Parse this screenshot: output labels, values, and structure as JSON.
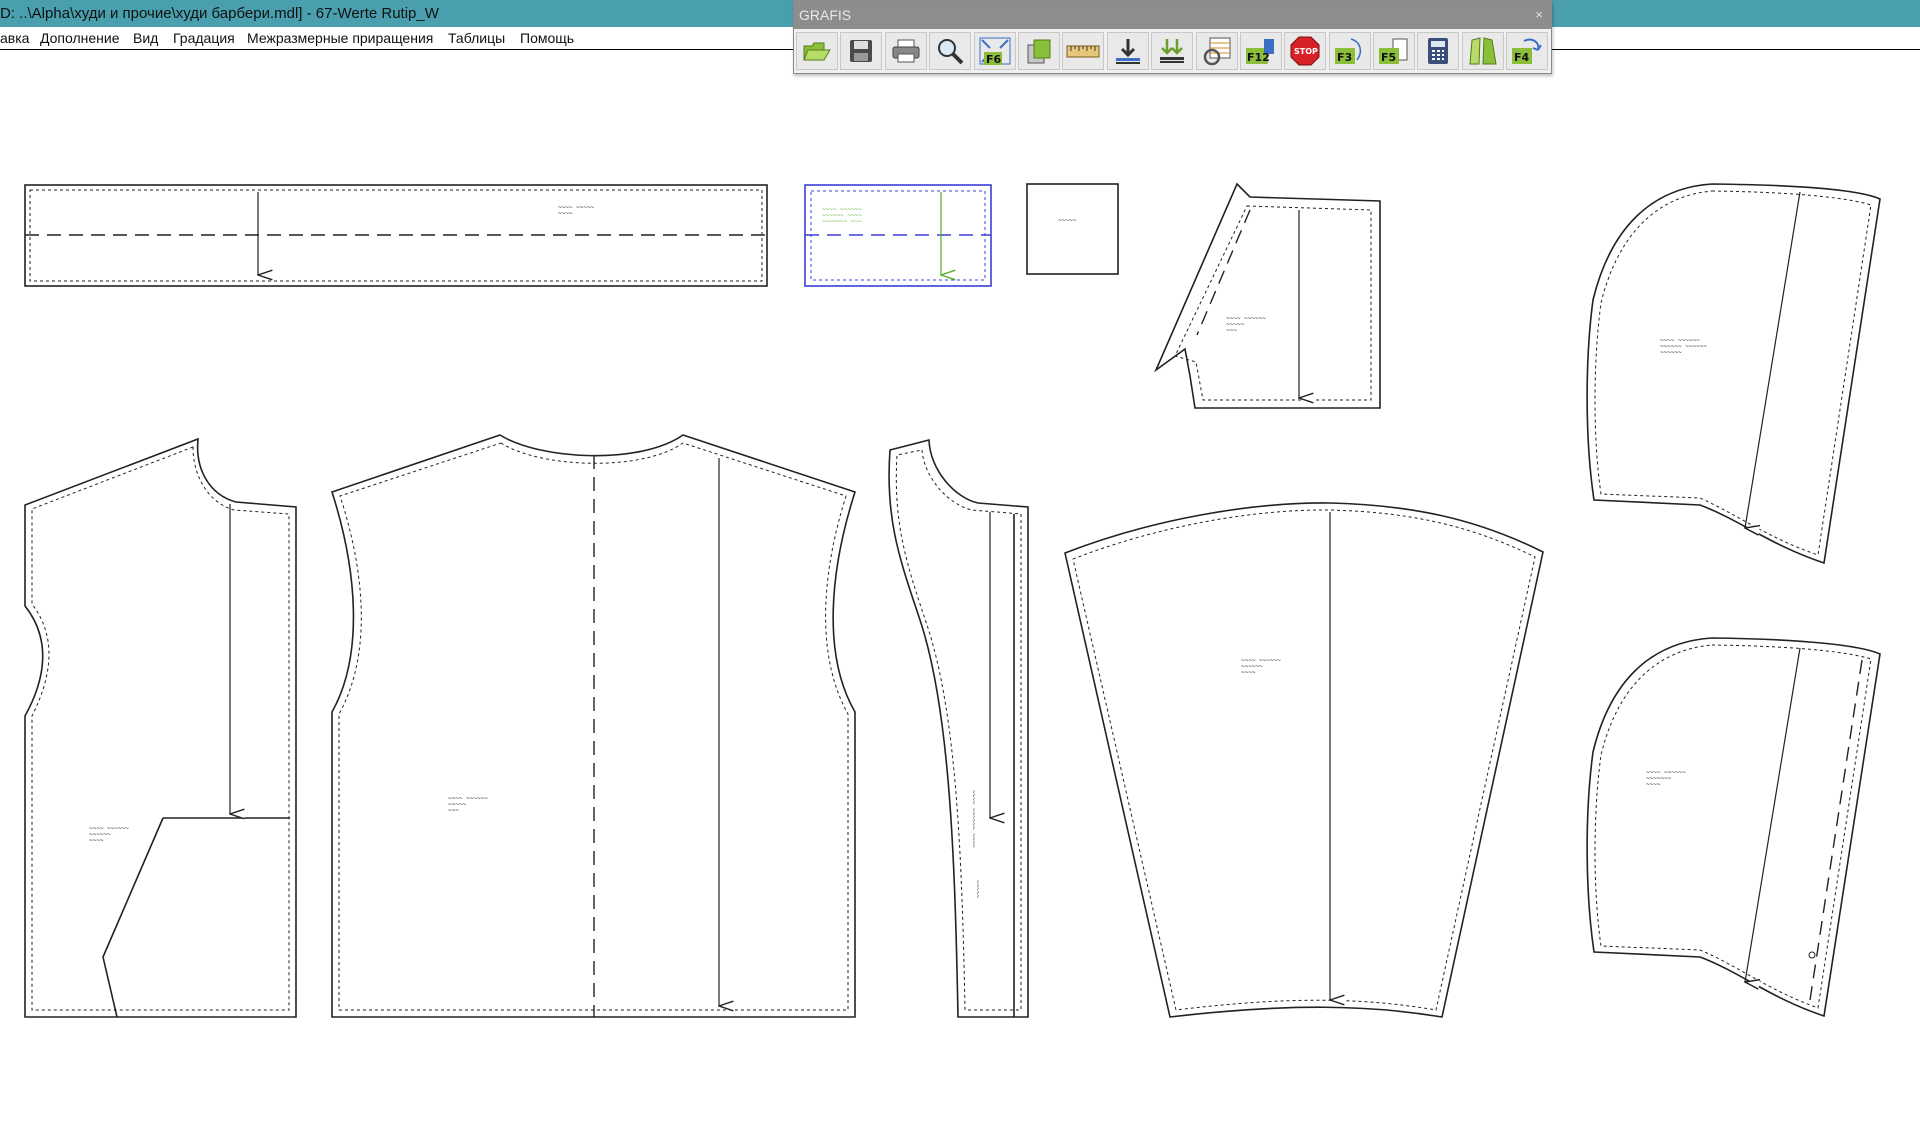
{
  "window": {
    "title": "D: ..\\Alpha\\худи и прочие\\худи барбери.mdl] - 67-Werte Rutip_W"
  },
  "menu": [
    "авка",
    "Дополнение",
    "Вид",
    "Градация",
    "Межразмерные приращения",
    "Таблицы",
    "Помощь"
  ],
  "toolbar": {
    "title": "GRAFIS",
    "close": "×",
    "tools": [
      {
        "name": "open-folder-icon",
        "label": ""
      },
      {
        "name": "save-icon",
        "label": ""
      },
      {
        "name": "print-icon",
        "label": ""
      },
      {
        "name": "zoom-icon",
        "label": ""
      },
      {
        "name": "fit-f6-icon",
        "label": "F6"
      },
      {
        "name": "pages-icon",
        "label": ""
      },
      {
        "name": "ruler-icon",
        "label": ""
      },
      {
        "name": "download-icon",
        "label": ""
      },
      {
        "name": "double-download-icon",
        "label": ""
      },
      {
        "name": "table-icon",
        "label": ""
      },
      {
        "name": "f12-icon",
        "label": "F12"
      },
      {
        "name": "stop-icon",
        "label": "STOP"
      },
      {
        "name": "f3-icon",
        "label": "F3"
      },
      {
        "name": "f5-icon",
        "label": "F5"
      },
      {
        "name": "calculator-icon",
        "label": ""
      },
      {
        "name": "pattern-pieces-icon",
        "label": ""
      },
      {
        "name": "f4-icon",
        "label": "F4"
      }
    ]
  },
  "colors": {
    "titlebar": "#4a9fae",
    "selection": "#3b3fd8",
    "selection_text": "#55b02a",
    "stop": "#d8222a",
    "tool_green": "#8bbf3a"
  }
}
